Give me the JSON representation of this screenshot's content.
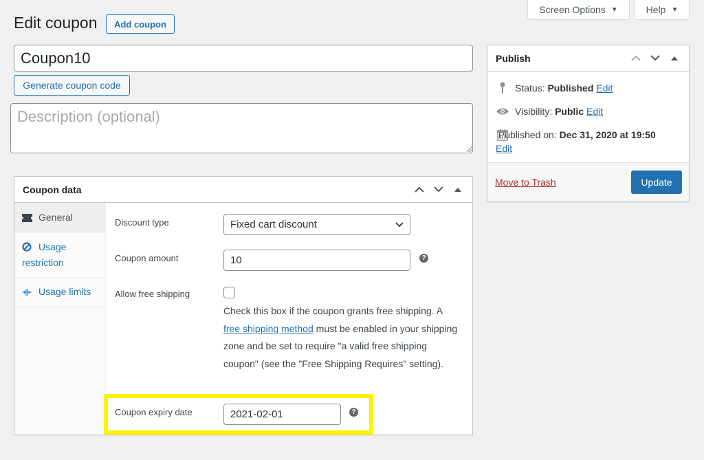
{
  "top_tabs": {
    "screen_options": "Screen Options",
    "help": "Help"
  },
  "header": {
    "title": "Edit coupon",
    "add_button": "Add coupon"
  },
  "coupon_code": {
    "value": "Coupon10",
    "generate_button": "Generate coupon code"
  },
  "description": {
    "value": "",
    "placeholder": "Description (optional)"
  },
  "coupon_data": {
    "title": "Coupon data",
    "tabs": [
      {
        "label": "General",
        "icon": "ticket-icon",
        "active": true
      },
      {
        "label": "Usage restriction",
        "icon": "block-icon",
        "active": false
      },
      {
        "label": "Usage limits",
        "icon": "limits-icon",
        "active": false
      }
    ],
    "fields": {
      "discount_type": {
        "label": "Discount type",
        "value": "Fixed cart discount"
      },
      "coupon_amount": {
        "label": "Coupon amount",
        "value": "10"
      },
      "free_shipping": {
        "label": "Allow free shipping",
        "checked": false,
        "desc_before": "Check this box if the coupon grants free shipping. A ",
        "desc_link": "free shipping method",
        "desc_after": " must be enabled in your shipping zone and be set to require \"a valid free shipping coupon\" (see the \"Free Shipping Requires\" setting)."
      },
      "expiry_date": {
        "label": "Coupon expiry date",
        "value": "2021-02-01"
      }
    },
    "help_glyph": "?"
  },
  "publish": {
    "title": "Publish",
    "status_label": "Status: ",
    "status_value": "Published",
    "visibility_label": "Visibility: ",
    "visibility_value": "Public",
    "published_on_label": "Published on: ",
    "published_on_value": "Dec 31, 2020 at 19:50",
    "edit_label": "Edit",
    "trash_label": "Move to Trash",
    "update_label": "Update"
  },
  "colors": {
    "accent": "#2271b1",
    "danger": "#b32d2e",
    "highlight": "#fff200",
    "background": "#f0f0f1"
  }
}
